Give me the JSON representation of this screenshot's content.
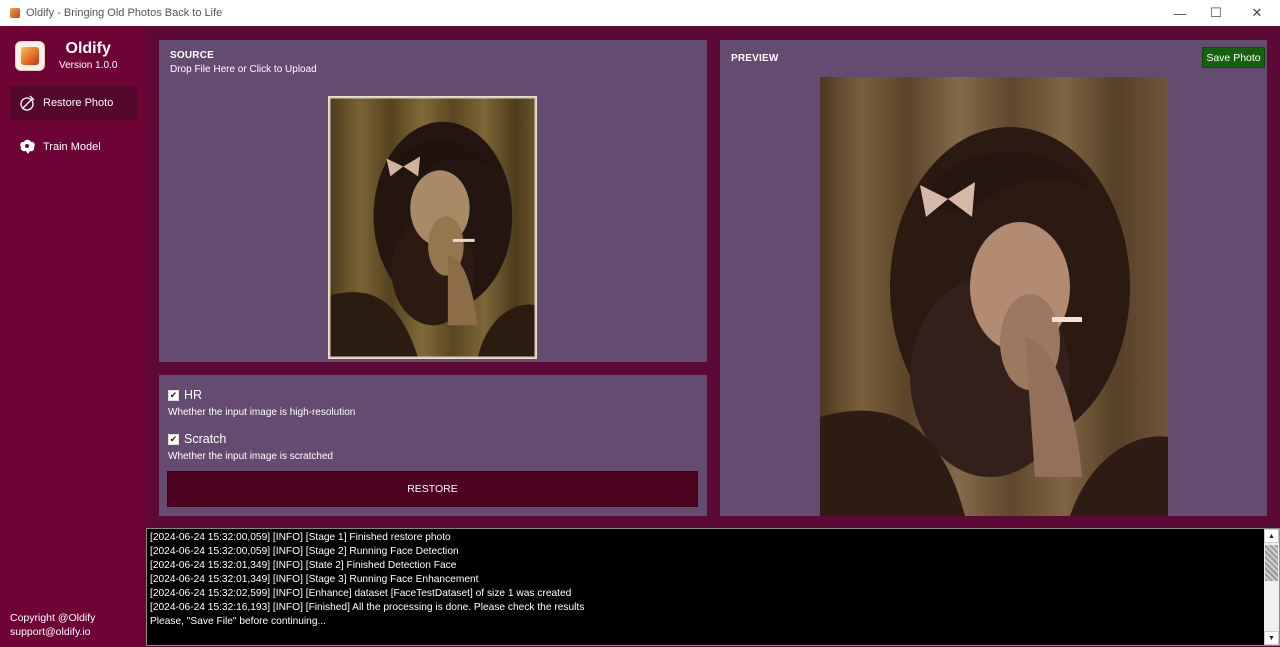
{
  "window": {
    "title": "Oldify -  Bringing Old Photos Back to Life",
    "minimize_glyph": "—",
    "maximize_glyph": "☐",
    "close_glyph": "✕"
  },
  "sidebar": {
    "app_name": "Oldify",
    "version": "Version 1.0.0",
    "items": [
      {
        "label": "Restore Photo",
        "icon": "restore-photo-icon",
        "active": true
      },
      {
        "label": "Train Model",
        "icon": "brain-icon",
        "active": false
      }
    ],
    "footer": {
      "copyright": "Copyright @Oldify",
      "email": "support@oldify.io"
    }
  },
  "source": {
    "heading": "SOURCE",
    "hint": "Drop File Here or Click to Upload"
  },
  "options": {
    "hr": {
      "label": "HR",
      "checked": true,
      "description": "Whether the input image is high-resolution"
    },
    "scratch": {
      "label": "Scratch",
      "checked": true,
      "description": "Whether the input image is scratched"
    },
    "restore_label": "RESTORE",
    "check_glyph": "✔"
  },
  "preview": {
    "heading": "PREVIEW",
    "save_label": "Save Photo"
  },
  "log": {
    "lines": [
      "[2024-06-24 15:32:00,059] [INFO] [Stage 1] Finished restore photo",
      "[2024-06-24 15:32:00,059] [INFO] [Stage 2] Running Face Detection",
      "[2024-06-24 15:32:01,349] [INFO] [State 2] Finished Detection Face",
      "[2024-06-24 15:32:01,349] [INFO] [Stage 3] Running Face Enhancement",
      "[2024-06-24 15:32:02,599] [INFO] [Enhance] dataset [FaceTestDataset] of size 1 was created",
      "[2024-06-24 15:32:16,193] [INFO] [Finished] All the processing is done. Please check the results",
      "Please, \"Save File\" before continuing..."
    ],
    "scroll_up_glyph": "▲",
    "scroll_down_glyph": "▼"
  },
  "colors": {
    "window_bg": "#5c0a35",
    "sidebar_bg": "#6e0436",
    "sidebar_active": "#55062b",
    "panel_bg": "#654b6f",
    "restore_button": "#4e0420",
    "save_button": "#16610e",
    "log_bg": "#000000"
  }
}
